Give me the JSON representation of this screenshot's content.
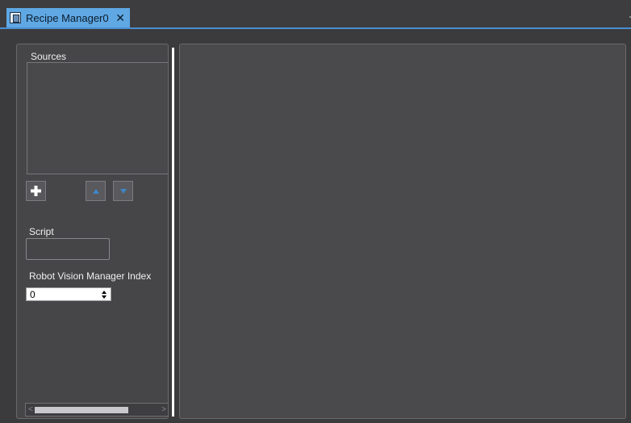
{
  "tab": {
    "title": "Recipe Manager0",
    "close_glyph": "✕",
    "icon": "document-icon"
  },
  "left_panel": {
    "sources_label": "Sources",
    "add_icon": "plus-icon",
    "move_up_icon": "arrow-up-icon",
    "move_down_icon": "arrow-down-icon",
    "script_label": "Script",
    "script_value": "",
    "rvm_index_label": "Robot Vision Manager Index",
    "rvm_index_value": "0"
  },
  "colors": {
    "tab_accent": "#5fa8e4",
    "background": "#3b3b3e",
    "panel": "#464649"
  }
}
